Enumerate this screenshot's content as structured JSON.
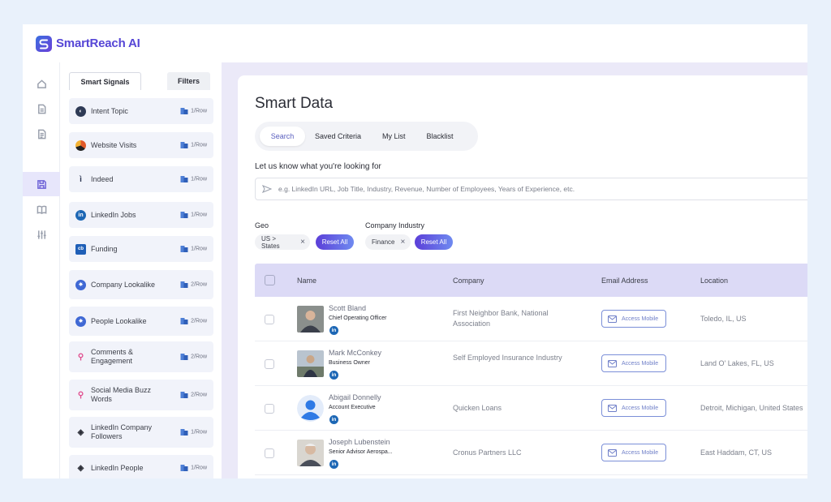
{
  "app": {
    "name": "SmartReach AI"
  },
  "signals_panel": {
    "tabs": [
      {
        "label": "Smart Signals"
      },
      {
        "label": "Filters"
      }
    ],
    "items": [
      {
        "label": "Intent Topic",
        "cost": "1/Row",
        "icon": "globe-icon"
      },
      {
        "label": "Website Visits",
        "cost": "1/Row",
        "icon": "pie-icon"
      },
      {
        "label": "Indeed",
        "cost": "1/Row",
        "icon": "indeed-icon"
      },
      {
        "label": "LinkedIn Jobs",
        "cost": "1/Row",
        "icon": "linkedin-icon"
      },
      {
        "label": "Funding",
        "cost": "1/Row",
        "icon": "crunchbase-icon"
      },
      {
        "label": "Company Lookalike",
        "cost": "2/Row",
        "icon": "network-icon"
      },
      {
        "label": "People Lookalike",
        "cost": "2/Row",
        "icon": "network-icon"
      },
      {
        "label": "Comments & Engagement",
        "cost": "2/Row",
        "icon": "branch-icon"
      },
      {
        "label": "Social Media Buzz Words",
        "cost": "2/Row",
        "icon": "branch-icon"
      },
      {
        "label": "LinkedIn Company Followers",
        "cost": "1/Row",
        "icon": "layers-icon"
      },
      {
        "label": "LinkedIn People",
        "cost": "1/Row",
        "icon": "layers-icon"
      }
    ]
  },
  "main": {
    "title": "Smart Data",
    "tabs": [
      {
        "label": "Search"
      },
      {
        "label": "Saved Criteria"
      },
      {
        "label": "My List"
      },
      {
        "label": "Blacklist"
      }
    ],
    "prompt": "Let us know what you're looking for",
    "search_placeholder": "e.g. LinkedIn URL, Job Title, Industry, Revenue, Number of Employees, Years of Experience, etc.",
    "filters": {
      "geo": {
        "label": "Geo",
        "chip": "US > States",
        "reset": "Reset All"
      },
      "industry": {
        "label": "Company Industry",
        "chip": "Finance",
        "reset": "Reset All"
      }
    },
    "table": {
      "columns": {
        "name": "Name",
        "company": "Company",
        "email": "Email Address",
        "location": "Location"
      },
      "access_label": "Access Mobile",
      "rows": [
        {
          "name": "Scott Bland",
          "title": "Chief Operating Officer",
          "company": "First Neighbor Bank, National Association",
          "location": "Toledo, IL, US"
        },
        {
          "name": "Mark McConkey",
          "title": "Business Owner",
          "company": "Self Employed Insurance Industry",
          "location": "Land O' Lakes, FL, US"
        },
        {
          "name": "Abigail Donnelly",
          "title": "Account Executive",
          "company": "Quicken Loans",
          "location": "Detroit, Michigan, United States"
        },
        {
          "name": "Joseph Lubenstein",
          "title": "Senior Advisor Aerospa...",
          "company": "Cronus Partners LLC",
          "location": "East Haddam, CT, US"
        }
      ]
    }
  },
  "colors": {
    "accent": "#5646d6",
    "header_row": "#dcdaf6",
    "main_bg": "#ebe9f8",
    "linkedin": "#1d67b5"
  }
}
